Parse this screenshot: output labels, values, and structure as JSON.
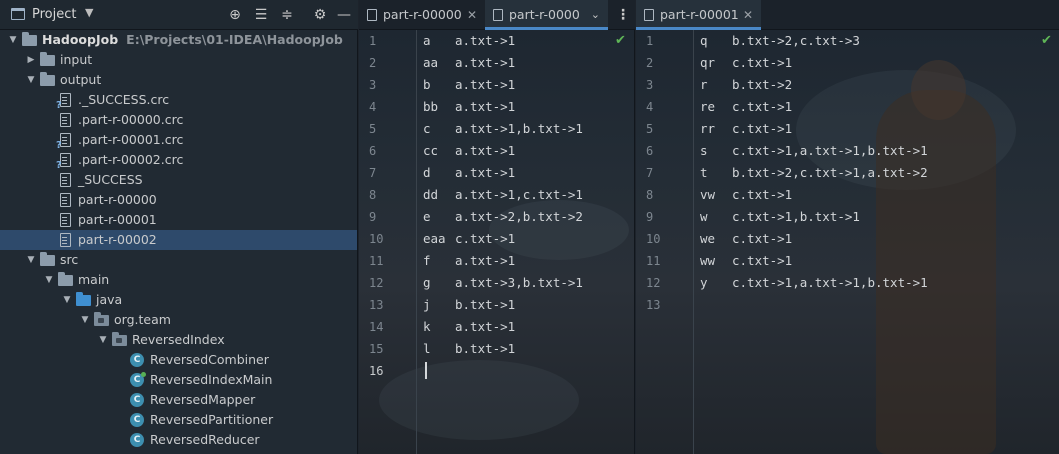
{
  "project_panel": {
    "title": "Project",
    "tree": [
      {
        "label": "HadoopJob",
        "path": "E:\\Projects\\01-IDEA\\HadoopJob",
        "type": "module",
        "depth": 0,
        "expanded": true
      },
      {
        "label": "input",
        "type": "folder",
        "depth": 1,
        "expanded": false
      },
      {
        "label": "output",
        "type": "folder",
        "depth": 1,
        "expanded": true
      },
      {
        "label": "._SUCCESS.crc",
        "type": "qfile",
        "depth": 2
      },
      {
        "label": ".part-r-00000.crc",
        "type": "file",
        "depth": 2
      },
      {
        "label": ".part-r-00001.crc",
        "type": "qfile",
        "depth": 2
      },
      {
        "label": ".part-r-00002.crc",
        "type": "qfile",
        "depth": 2
      },
      {
        "label": "_SUCCESS",
        "type": "file",
        "depth": 2
      },
      {
        "label": "part-r-00000",
        "type": "file",
        "depth": 2
      },
      {
        "label": "part-r-00001",
        "type": "file",
        "depth": 2
      },
      {
        "label": "part-r-00002",
        "type": "file",
        "depth": 2,
        "selected": true
      },
      {
        "label": "src",
        "type": "folder",
        "depth": 1,
        "expanded": true
      },
      {
        "label": "main",
        "type": "folder",
        "depth": 2,
        "expanded": true
      },
      {
        "label": "java",
        "type": "folder-blue",
        "depth": 3,
        "expanded": true
      },
      {
        "label": "org.team",
        "type": "package",
        "depth": 4,
        "expanded": true
      },
      {
        "label": "ReversedIndex",
        "type": "package",
        "depth": 5,
        "expanded": true
      },
      {
        "label": "ReversedCombiner",
        "type": "class",
        "depth": 6
      },
      {
        "label": "ReversedIndexMain",
        "type": "class-main",
        "depth": 6
      },
      {
        "label": "ReversedMapper",
        "type": "class",
        "depth": 6
      },
      {
        "label": "ReversedPartitioner",
        "type": "class",
        "depth": 6
      },
      {
        "label": "ReversedReducer",
        "type": "class",
        "depth": 6
      }
    ]
  },
  "left_pane": {
    "tabs": [
      {
        "label": "part-r-00000",
        "active": false
      },
      {
        "label": "part-r-0000",
        "active": true
      }
    ],
    "line_count": 16,
    "current_line": 16,
    "lines": [
      {
        "key": "a",
        "value": "a.txt->1"
      },
      {
        "key": "aa",
        "value": "a.txt->1"
      },
      {
        "key": "b",
        "value": "a.txt->1"
      },
      {
        "key": "bb",
        "value": "a.txt->1"
      },
      {
        "key": "c",
        "value": "a.txt->1,b.txt->1"
      },
      {
        "key": "cc",
        "value": "a.txt->1"
      },
      {
        "key": "d",
        "value": "a.txt->1"
      },
      {
        "key": "dd",
        "value": "a.txt->1,c.txt->1"
      },
      {
        "key": "e",
        "value": "a.txt->2,b.txt->2"
      },
      {
        "key": "eaa",
        "value": "c.txt->1"
      },
      {
        "key": "f",
        "value": "a.txt->1"
      },
      {
        "key": "g",
        "value": "a.txt->3,b.txt->1"
      },
      {
        "key": "j",
        "value": "b.txt->1"
      },
      {
        "key": "k",
        "value": "a.txt->1"
      },
      {
        "key": "l",
        "value": "b.txt->1"
      }
    ]
  },
  "right_pane": {
    "tabs": [
      {
        "label": "part-r-00001",
        "active": true
      }
    ],
    "line_count": 13,
    "lines": [
      {
        "key": "q",
        "value": "b.txt->2,c.txt->3"
      },
      {
        "key": "qr",
        "value": "c.txt->1"
      },
      {
        "key": "r",
        "value": "b.txt->2"
      },
      {
        "key": "re",
        "value": "c.txt->1"
      },
      {
        "key": "rr",
        "value": "c.txt->1"
      },
      {
        "key": "s",
        "value": "c.txt->1,a.txt->1,b.txt->1"
      },
      {
        "key": "t",
        "value": "b.txt->2,c.txt->1,a.txt->2"
      },
      {
        "key": "vw",
        "value": "c.txt->1"
      },
      {
        "key": "w",
        "value": "c.txt->1,b.txt->1"
      },
      {
        "key": "we",
        "value": "c.txt->1"
      },
      {
        "key": "ww",
        "value": "c.txt->1"
      },
      {
        "key": "y",
        "value": "c.txt->1,a.txt->1,b.txt->1"
      }
    ]
  },
  "colors": {
    "accent": "#4a88c7",
    "selection": "#2e4a6b",
    "check": "#5fb657"
  },
  "icons": [
    "project-icon",
    "chevron-down-icon",
    "locate-icon",
    "expand-all-icon",
    "collapse-all-icon",
    "gear-icon",
    "minimize-icon",
    "close-icon",
    "more-icon",
    "check-icon"
  ]
}
